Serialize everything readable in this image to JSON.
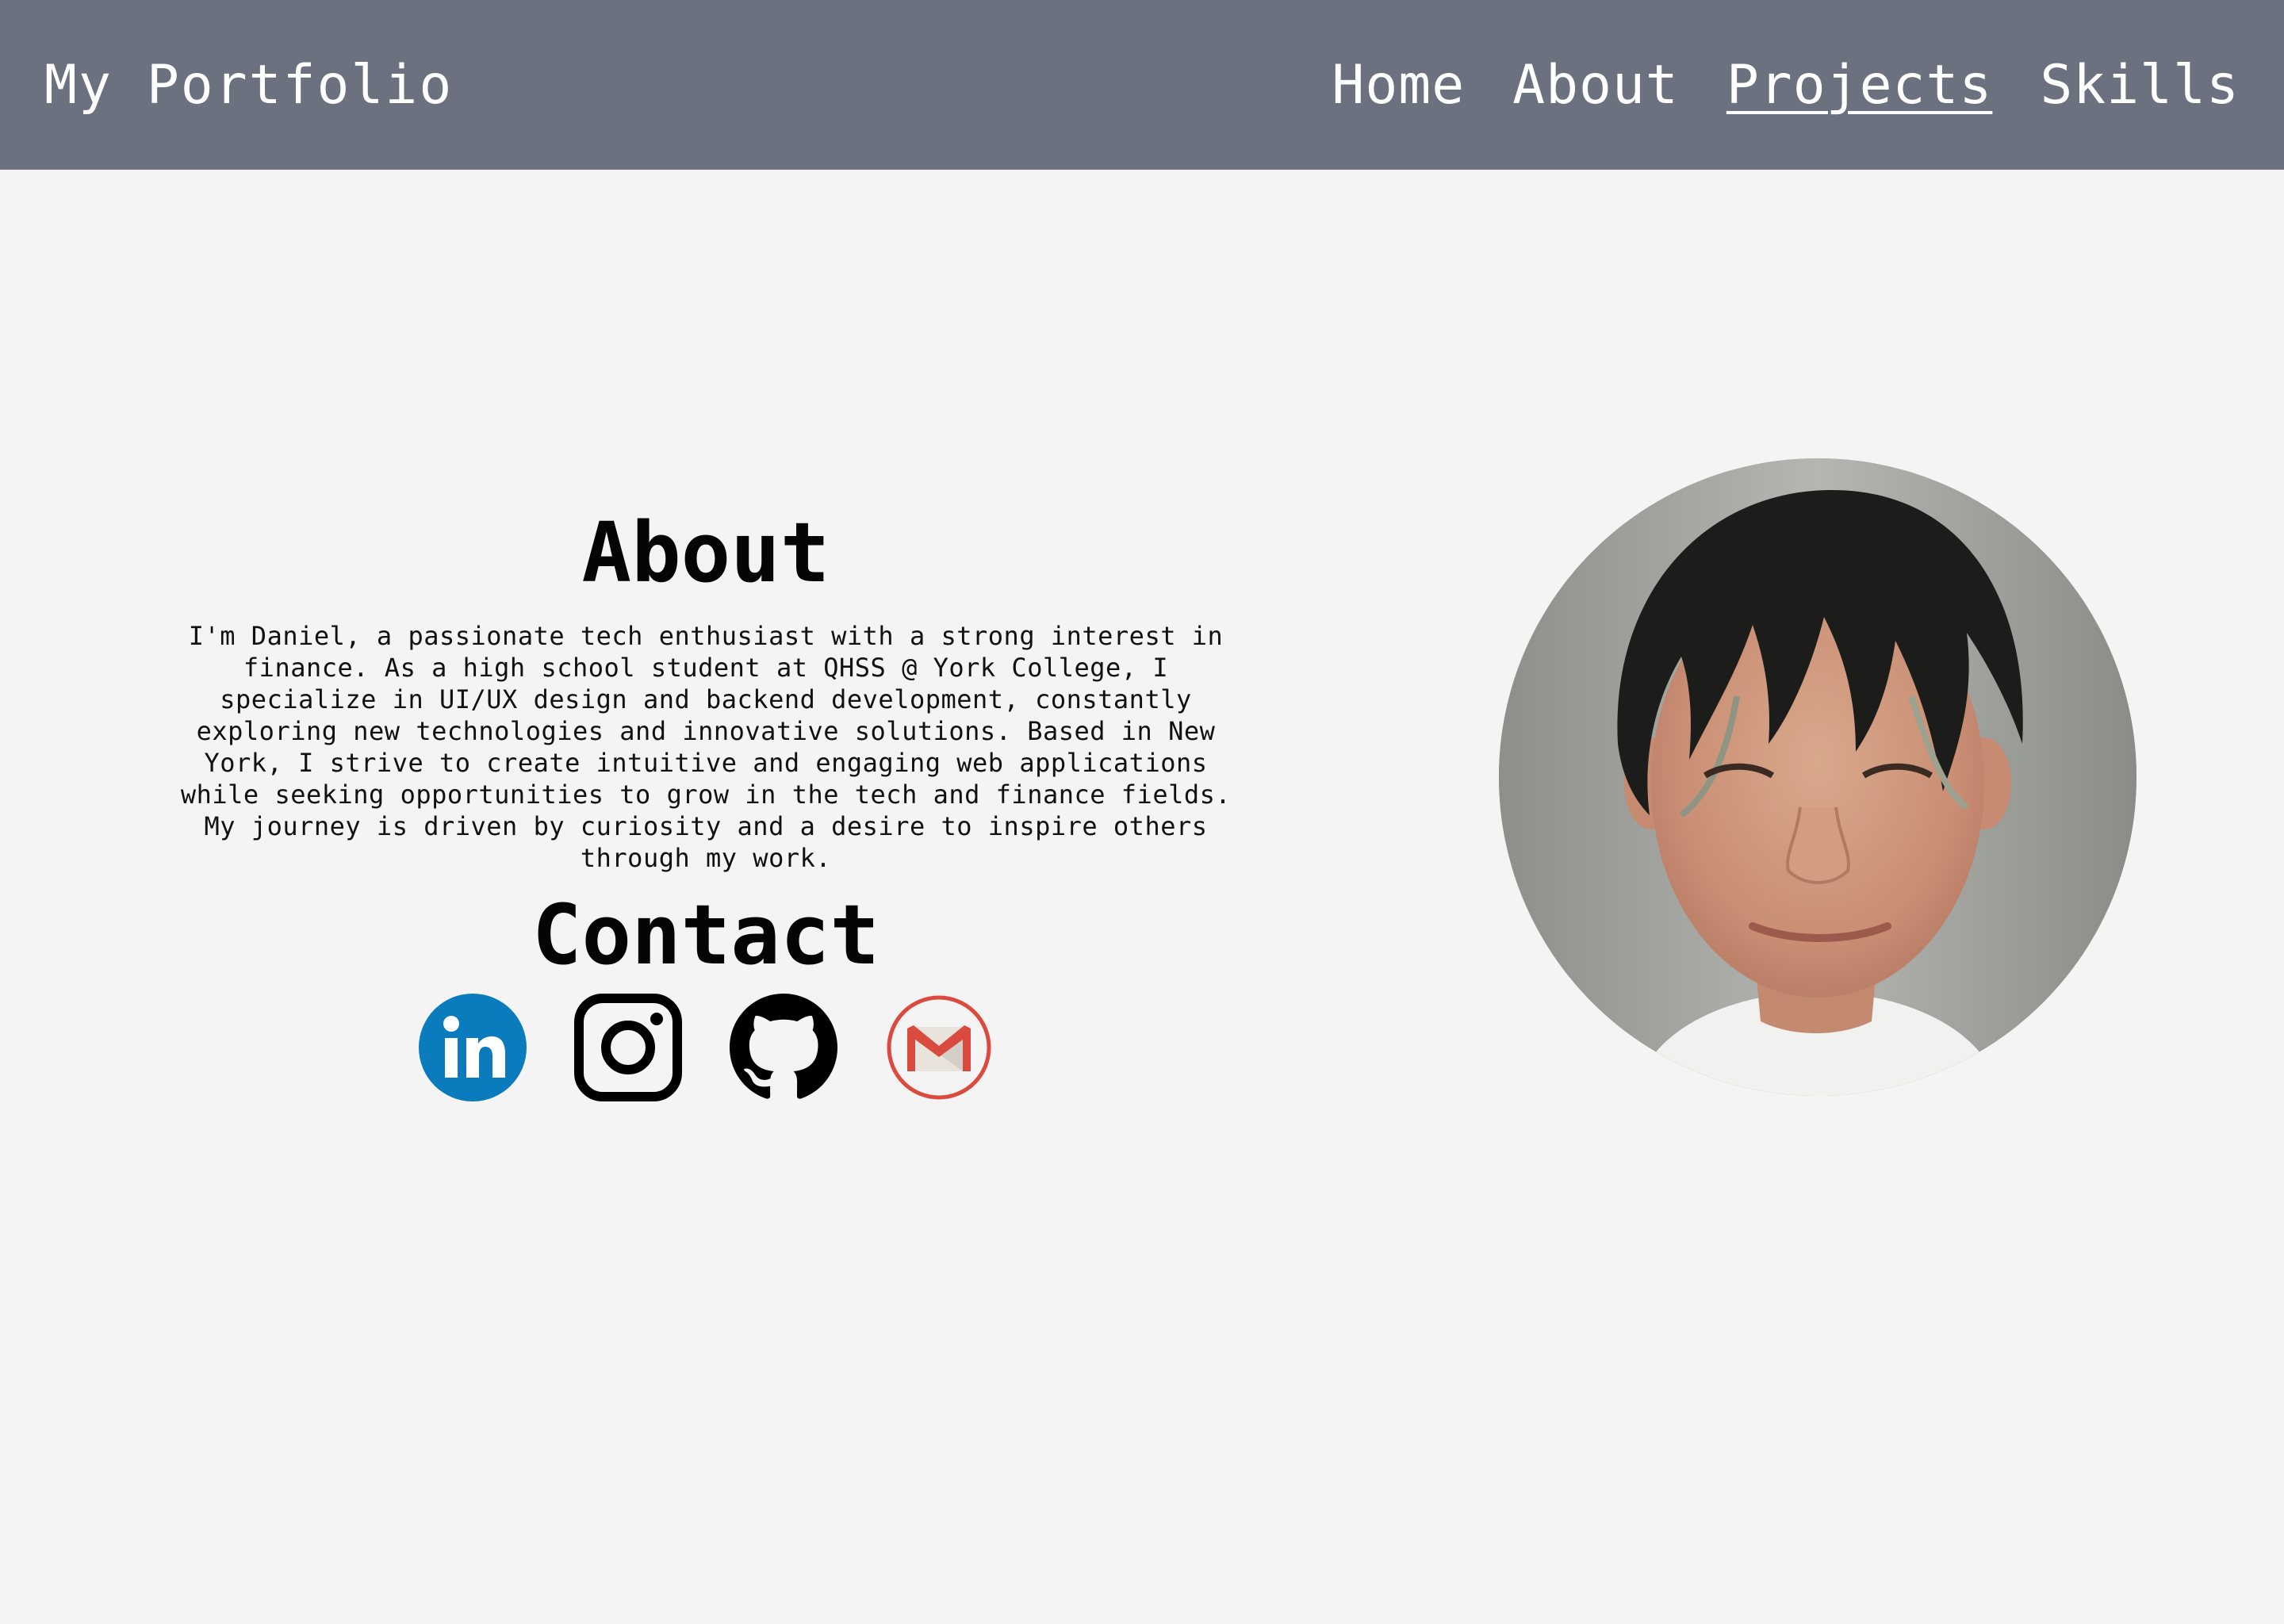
{
  "header": {
    "brand": "My Portfolio",
    "nav": [
      {
        "label": "Home"
      },
      {
        "label": "About"
      },
      {
        "label": "Projects",
        "active": true
      },
      {
        "label": "Skills"
      }
    ]
  },
  "about": {
    "title": "About",
    "text": "I'm Daniel, a passionate tech enthusiast with a strong interest in finance. As a high school student at QHSS @ York College, I specialize in UI/UX design and backend development, constantly exploring new technologies and innovative solutions. Based in New York, I strive to create intuitive and engaging web applications while seeking opportunities to grow in the tech and finance fields. My journey is driven by curiosity and a desire to inspire others through my work."
  },
  "contact": {
    "title": "Contact",
    "icons": [
      "linkedin-icon",
      "instagram-icon",
      "github-icon",
      "gmail-icon"
    ]
  },
  "colors": {
    "navbar_bg": "#6b717f",
    "page_bg": "#f4f4f4",
    "linkedin": "#0a7bbd",
    "gmail": "#db4a3f"
  }
}
